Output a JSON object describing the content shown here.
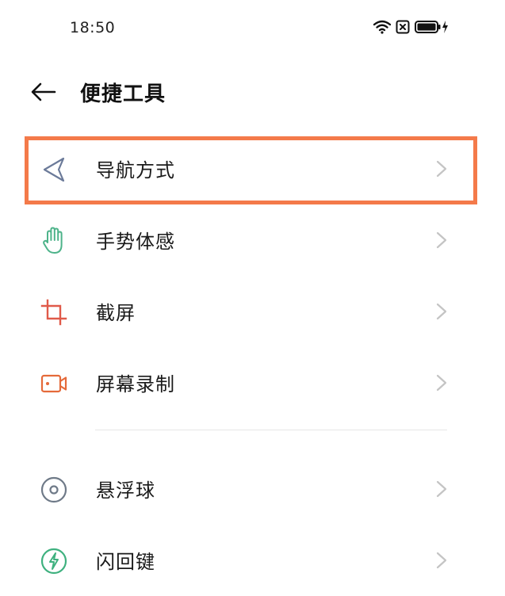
{
  "status_bar": {
    "time": "18:50",
    "icons": [
      "wifi-icon",
      "sim-off-icon",
      "battery-charging-icon"
    ]
  },
  "header": {
    "back_icon": "arrow-left-icon",
    "title": "便捷工具"
  },
  "colors": {
    "highlight": "#f47a4a",
    "nav_icon": "#6b7a99",
    "gesture_icon": "#4db38a",
    "screenshot_icon": "#e05a4a",
    "record_icon": "#e56a3a",
    "float_icon": "#6f7a88",
    "flash_icon": "#3fb17f"
  },
  "items": [
    {
      "label": "导航方式",
      "icon": "navigation-arrow-icon",
      "highlighted": true
    },
    {
      "label": "手势体感",
      "icon": "hand-gesture-icon"
    },
    {
      "label": "截屏",
      "icon": "crop-icon"
    },
    {
      "label": "屏幕录制",
      "icon": "video-record-icon"
    },
    {
      "label": "悬浮球",
      "icon": "floating-ball-icon"
    },
    {
      "label": "闪回键",
      "icon": "flash-key-icon"
    }
  ]
}
